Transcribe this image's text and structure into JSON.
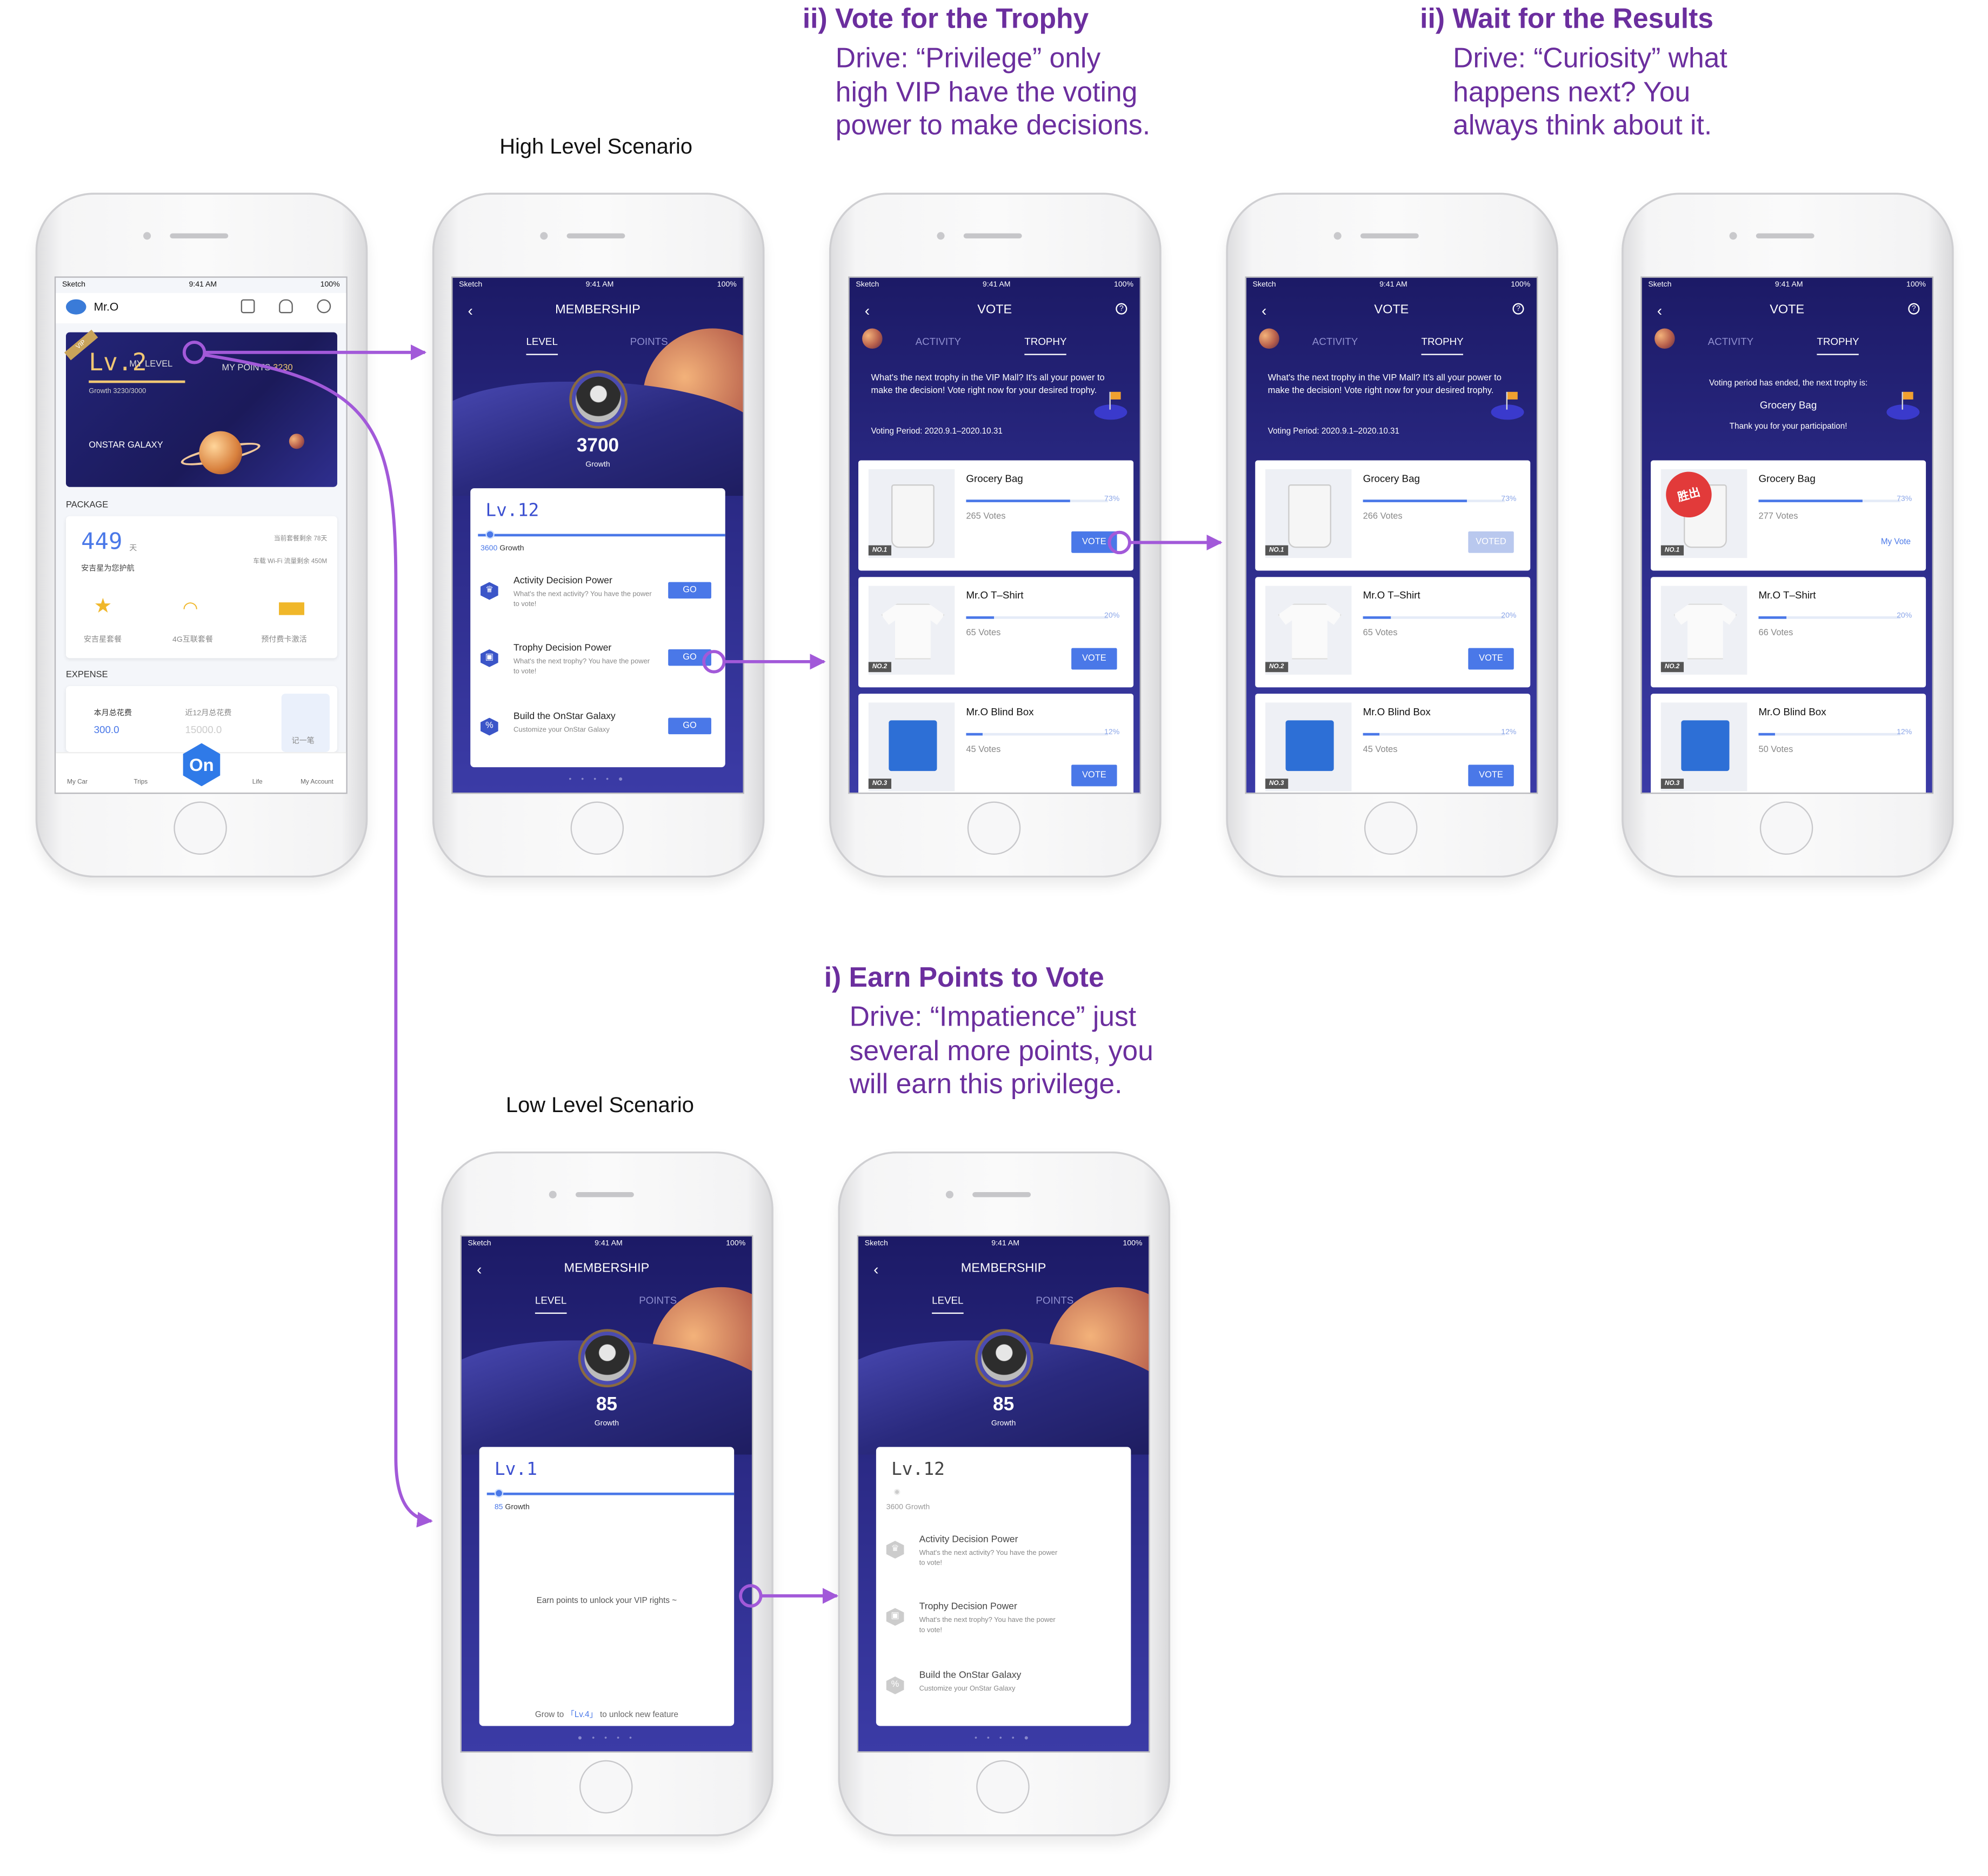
{
  "annotations": [
    {
      "heading": "ii) Vote for the Trophy",
      "body": "Drive: “Privilege” only\nhigh VIP have the voting\npower to make decisions."
    },
    {
      "heading": "ii) Wait for the Results",
      "body": "Drive: “Curiosity” what\nhappens next? You\nalways think about it."
    },
    {
      "heading": "i) Earn Points to Vote",
      "body": "Drive: “Impatience” just\nseveral more points, you\nwill earn this privilege."
    }
  ],
  "scenarios": {
    "high": "High Level Scenario",
    "low": "Low Level Scenario"
  },
  "status_bar": {
    "carrier": "Sketch",
    "time": "9:41 AM",
    "battery": "100%"
  },
  "home": {
    "username": "Mr.O",
    "vip_badge": "VIP",
    "level": "Lv.2",
    "my_level_label": "MY LEVEL",
    "my_points_label": "MY POINTS",
    "my_points_value": "3230",
    "growth_text": "Growth  3230/3000",
    "galaxy_label": "ONSTAR GALAXY",
    "package_label": "PACKAGE",
    "days_value": "449",
    "days_unit": "天",
    "days_caption": "安吉星为您护航",
    "pkg_note1": "当前套餐剩余 78天",
    "pkg_note2": "车载 Wi-Fi 流量剩余 450M",
    "pkg_items": [
      "安吉星套餐",
      "4G互联套餐",
      "预付费卡激活"
    ],
    "expense_label": "EXPENSE",
    "exp_month_label": "本月总花费",
    "exp_month_value": "300.0",
    "exp_12m_label": "近12月总花费",
    "exp_12m_value": "15000.0",
    "exp_note": "记一笔",
    "tabs": [
      "My Car",
      "Trips",
      "On",
      "Life",
      "My Account"
    ]
  },
  "membership": {
    "title": "MEMBERSHIP",
    "tab_level": "LEVEL",
    "tab_points": "POINTS",
    "growth_label": "Growth",
    "high_growth": "3700",
    "low_growth": "85",
    "high_level": "Lv.12",
    "low_level": "Lv.1",
    "high_bar_growth": "3600",
    "low_bar_growth": "85",
    "powers": [
      {
        "title": "Activity Decision Power",
        "desc": "What's the next activity? You have the power to vote!",
        "btn": "GO"
      },
      {
        "title": "Trophy Decision Power",
        "desc": "What's the next trophy? You have the power to vote!",
        "btn": "GO"
      },
      {
        "title": "Build the OnStar Galaxy",
        "desc": "Customize your OnStar Galaxy",
        "btn": "GO"
      }
    ],
    "low_message": "Earn points to unlock your VIP rights ~",
    "low_foot_pre": "Grow to",
    "low_foot_lv": "「Lv.4」",
    "low_foot_post": "to unlock new feature"
  },
  "vote": {
    "title": "VOTE",
    "tab_activity": "ACTIVITY",
    "tab_trophy": "TROPHY",
    "intro": "What's the next trophy in the VIP Mall? It's all your power to make the decision! Vote right now for your desired trophy.",
    "period": "Voting Period: 2020.9.1–2020.10.31",
    "ended_line1": "Voting period has ended, the next trophy is:",
    "ended_item": "Grocery Bag",
    "ended_line2": "Thank you for your participation!",
    "vote_label": "VOTE",
    "voted_label": "VOTED",
    "my_vote_label": "My Vote",
    "stamp_text": "胜出",
    "items": [
      {
        "no": "NO.1",
        "name": "Grocery Bag",
        "pct": "73%",
        "pct_value": 73,
        "votes": [
          "265 Votes",
          "266 Votes",
          "277 Votes"
        ]
      },
      {
        "no": "NO.2",
        "name": "Mr.O T–Shirt",
        "pct": "20%",
        "pct_value": 20,
        "votes": [
          "65 Votes",
          "65 Votes",
          "66 Votes"
        ]
      },
      {
        "no": "NO.3",
        "name": "Mr.O Blind Box",
        "pct": "12%",
        "pct_value": 12,
        "votes": [
          "45 Votes",
          "45 Votes",
          "50 Votes"
        ]
      }
    ]
  },
  "colors": {
    "accent": "#4a78e8",
    "annotation": "#6b2e9e",
    "arrow": "#a259d9",
    "night": "#1d1c5e"
  }
}
